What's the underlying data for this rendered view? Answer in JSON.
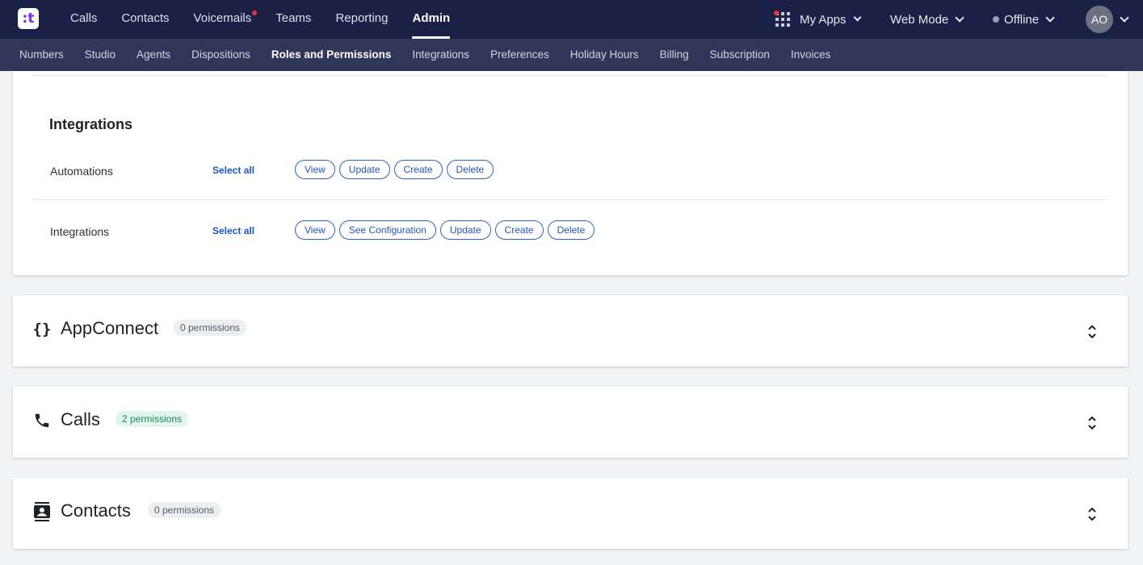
{
  "logo": {
    "glyph": "꞉t"
  },
  "topnav": {
    "items": [
      {
        "label": "Calls"
      },
      {
        "label": "Contacts"
      },
      {
        "label": "Voicemails"
      },
      {
        "label": "Teams"
      },
      {
        "label": "Reporting"
      },
      {
        "label": "Admin"
      }
    ]
  },
  "right": {
    "apps_label": "My Apps",
    "mode_label": "Web Mode",
    "status_label": "Offline",
    "avatar_initials": "AO"
  },
  "subnav": {
    "items": [
      {
        "label": "Numbers"
      },
      {
        "label": "Studio"
      },
      {
        "label": "Agents"
      },
      {
        "label": "Dispositions"
      },
      {
        "label": "Roles and Permissions"
      },
      {
        "label": "Integrations"
      },
      {
        "label": "Preferences"
      },
      {
        "label": "Holiday Hours"
      },
      {
        "label": "Billing"
      },
      {
        "label": "Subscription"
      },
      {
        "label": "Invoices"
      }
    ]
  },
  "integrations_section": {
    "title": "Integrations",
    "rows": [
      {
        "label": "Automations",
        "select_all": "Select all",
        "actions": [
          "View",
          "Update",
          "Create",
          "Delete"
        ]
      },
      {
        "label": "Integrations",
        "select_all": "Select all",
        "actions": [
          "View",
          "See Configuration",
          "Update",
          "Create",
          "Delete"
        ]
      }
    ]
  },
  "groups": [
    {
      "title": "AppConnect",
      "icon": "{}",
      "badge": "0 permissions"
    },
    {
      "title": "Calls",
      "icon": "phone-icon",
      "badge": "2 permissions"
    },
    {
      "title": "Contacts",
      "icon": "contacts-icon",
      "badge": "0 permissions"
    }
  ],
  "colors": {
    "topbar": "#1b2046",
    "subbar": "#2f3657",
    "accent_blue": "#2555b8",
    "badge_green": "#1a8a5a",
    "notification_red": "#e8333b"
  }
}
